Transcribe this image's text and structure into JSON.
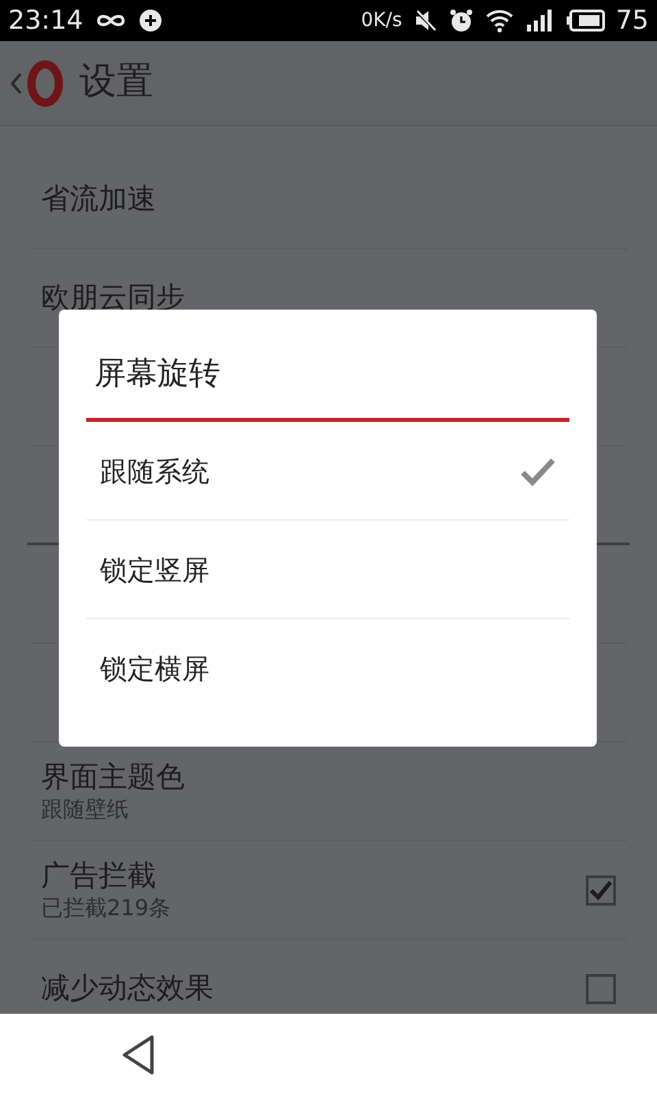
{
  "status_bar": {
    "time": "23:14",
    "net_speed": "0K/s",
    "battery": "75"
  },
  "header": {
    "title": "设置"
  },
  "settings": [
    {
      "kind": "row",
      "title": "省流加速"
    },
    {
      "kind": "row",
      "title": "欧朋云同步"
    },
    {
      "kind": "covered_row"
    },
    {
      "kind": "covered_section"
    },
    {
      "kind": "covered_row"
    },
    {
      "kind": "covered_row"
    },
    {
      "kind": "row",
      "title": "界面主题色",
      "subtitle": "跟随壁纸"
    },
    {
      "kind": "checkbox",
      "title": "广告拦截",
      "subtitle": "已拦截219条",
      "checked": true
    },
    {
      "kind": "checkbox",
      "title": "减少动态效果",
      "checked": false
    }
  ],
  "dialog": {
    "title": "屏幕旋转",
    "options": [
      {
        "label": "跟随系统",
        "selected": true
      },
      {
        "label": "锁定竖屏",
        "selected": false
      },
      {
        "label": "锁定横屏",
        "selected": false
      }
    ]
  }
}
